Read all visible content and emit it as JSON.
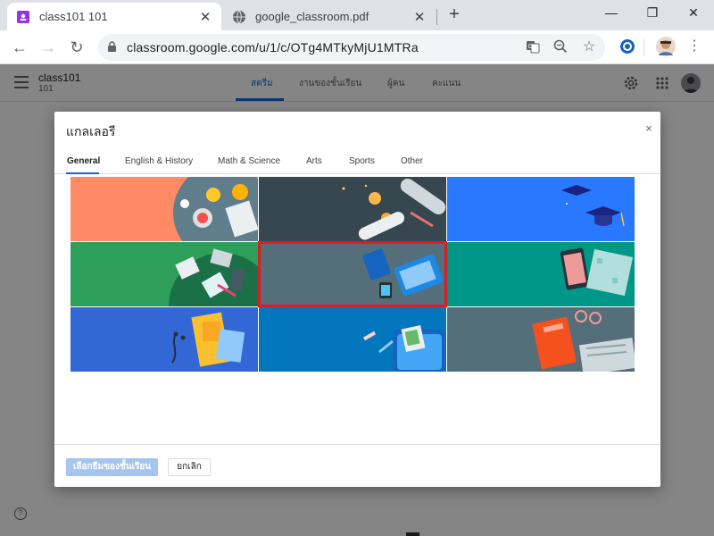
{
  "browser": {
    "tabs": [
      {
        "title": "class101 101",
        "active": true
      },
      {
        "title": "google_classroom.pdf",
        "active": false
      }
    ],
    "new_tab_label": "+",
    "window_controls": {
      "minimize": "—",
      "maximize": "❐",
      "close": "✕"
    },
    "url": "classroom.google.com/u/1/c/OTg4MTkyMjU1MTRa"
  },
  "classroom": {
    "class_name": "class101",
    "section": "101",
    "tabs": [
      "สตรีม",
      "งานของชั้นเรียน",
      "ผู้คน",
      "คะแนน"
    ],
    "active_tab": "สตรีม",
    "help": "?"
  },
  "dialog": {
    "title": "แกลเลอรี",
    "close": "×",
    "tabs": [
      "General",
      "English & History",
      "Math & Science",
      "Arts",
      "Sports",
      "Other"
    ],
    "active_tab": "General",
    "selected_theme_index": 4,
    "themes": [
      {
        "name": "theme-coffee",
        "color": "#ff8a65"
      },
      {
        "name": "theme-scroll",
        "color": "#37474f"
      },
      {
        "name": "theme-graduation",
        "color": "#1a73e8"
      },
      {
        "name": "theme-books",
        "color": "#2e9e5b"
      },
      {
        "name": "theme-laptop",
        "color": "#546e7a"
      },
      {
        "name": "theme-phone",
        "color": "#009688"
      },
      {
        "name": "theme-notebook",
        "color": "#3367d6"
      },
      {
        "name": "theme-backpack",
        "color": "#0277bd"
      },
      {
        "name": "theme-reading",
        "color": "#546e7a"
      }
    ],
    "select_button": "เลือกธีมของชั้นเรียน",
    "cancel_button": "ยกเลิก"
  },
  "colors": {
    "accent": "#1967d2",
    "selection": "#e11b22",
    "primary_disabled": "#a6c4f0"
  }
}
